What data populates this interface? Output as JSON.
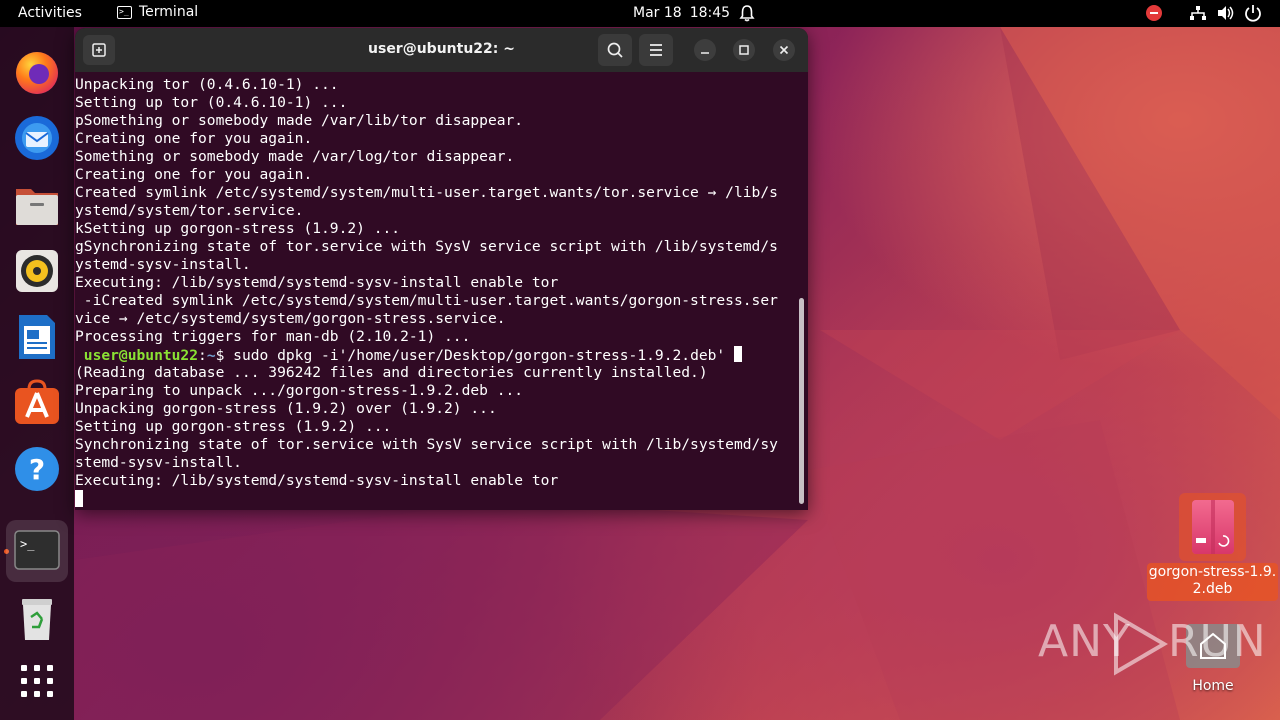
{
  "topbar": {
    "activities": "Activities",
    "app_name": "Terminal",
    "date": "Mar 18",
    "time": "18:45"
  },
  "dock": {
    "items": [
      {
        "name": "firefox"
      },
      {
        "name": "thunderbird"
      },
      {
        "name": "files"
      },
      {
        "name": "rhythmbox"
      },
      {
        "name": "libreoffice-writer"
      },
      {
        "name": "ubuntu-software"
      },
      {
        "name": "help"
      },
      {
        "name": "terminal",
        "active": true
      },
      {
        "name": "trash"
      },
      {
        "name": "show-applications"
      }
    ]
  },
  "terminal": {
    "title": "user@ubuntu22: ~",
    "lines": [
      "Unpacking tor (0.4.6.10-1) ...",
      "Setting up tor (0.4.6.10-1) ...",
      "pSomething or somebody made /var/lib/tor disappear.",
      "Creating one for you again.",
      "Something or somebody made /var/log/tor disappear.",
      "Creating one for you again.",
      "Created symlink /etc/systemd/system/multi-user.target.wants/tor.service → /lib/s",
      "ystemd/system/tor.service.",
      "kSetting up gorgon-stress (1.9.2) ...",
      "gSynchronizing state of tor.service with SysV service script with /lib/systemd/s",
      "ystemd-sysv-install.",
      "Executing: /lib/systemd/systemd-sysv-install enable tor",
      " -iCreated symlink /etc/systemd/system/multi-user.target.wants/gorgon-stress.ser",
      "vice → /etc/systemd/system/gorgon-stress.service.",
      "Processing triggers for man-db (2.10.2-1) ..."
    ],
    "prompt": {
      "user_host": " user@ubuntu22",
      "colon": ":",
      "path": "~",
      "command": "$ sudo dpkg -i'/home/user/Desktop/gorgon-stress-1.9.2.deb' "
    },
    "lines_after": [
      "(Reading database ... 396242 files and directories currently installed.)",
      "Preparing to unpack .../gorgon-stress-1.9.2.deb ...",
      "Unpacking gorgon-stress (1.9.2) over (1.9.2) ...",
      "Setting up gorgon-stress (1.9.2) ...",
      "Synchronizing state of tor.service with SysV service script with /lib/systemd/sy",
      "stemd-sysv-install.",
      "Executing: /lib/systemd/systemd-sysv-install enable tor"
    ]
  },
  "desktop": {
    "deb_label_line1": "gorgon-stress-1.9.",
    "deb_label_line2": "2.deb",
    "home_label": "Home"
  },
  "watermark": {
    "left": "ANY",
    "right": "RUN"
  },
  "colors": {
    "terminal_bg": "#300a24",
    "prompt_user": "#8ae234",
    "prompt_path": "#729fcf",
    "accent": "#e95420"
  }
}
